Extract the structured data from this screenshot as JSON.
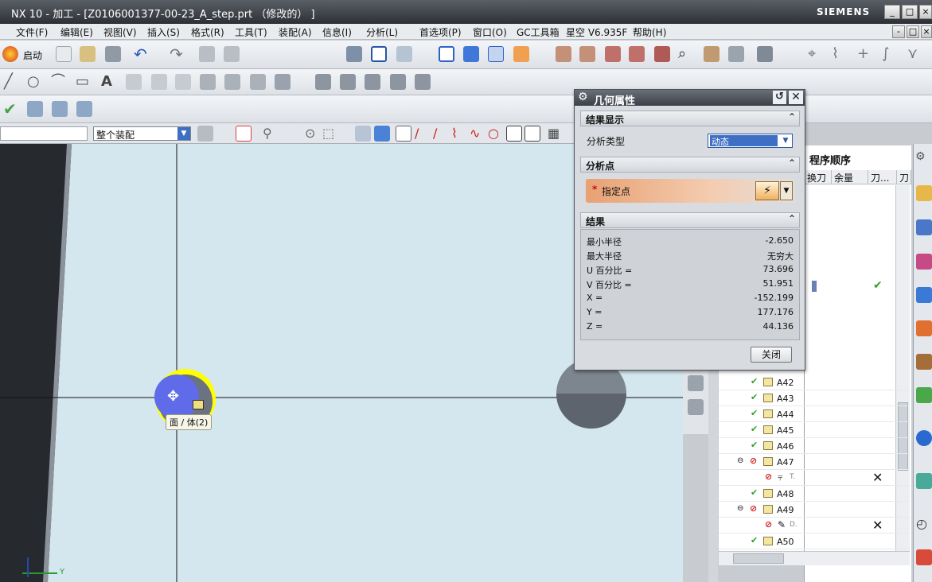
{
  "window": {
    "title": "NX 10 - 加工 - [Z0106001377-00-23_A_step.prt （修改的） ]",
    "brand": "SIEMENS"
  },
  "menu": [
    "文件(F)",
    "编辑(E)",
    "视图(V)",
    "插入(S)",
    "格式(R)",
    "工具(T)",
    "装配(A)",
    "信息(I)",
    "分析(L)",
    "首选项(P)",
    "窗口(O)",
    "GC工具箱",
    "星空 V6.935F",
    "帮助(H)"
  ],
  "toolbar": {
    "start_label": "启动",
    "assembly_filter": "整个装配"
  },
  "graphics": {
    "tooltip": "面 / 体(2)",
    "axis_label": "Y"
  },
  "dialog": {
    "title": "几何属性",
    "section_result_display": "结果显示",
    "analysis_type_label": "分析类型",
    "analysis_type_value": "动态",
    "section_analysis_point": "分析点",
    "point_required_mark": "*",
    "point_label": "指定点",
    "section_results": "结果",
    "results": [
      {
        "label": "最小半径",
        "value": "-2.650"
      },
      {
        "label": "最大半径",
        "value": "无穷大"
      },
      {
        "label": "U 百分比 =",
        "value": "73.696"
      },
      {
        "label": "V 百分比 =",
        "value": "51.951"
      },
      {
        "label": "X =",
        "value": "-152.199"
      },
      {
        "label": "Y =",
        "value": "177.176"
      },
      {
        "label": "Z =",
        "value": "44.136"
      }
    ],
    "close_label": "关闭"
  },
  "navigator": {
    "title": "程序顺序",
    "columns": [
      "换刀",
      "余量",
      "刀...",
      "刀"
    ],
    "operations": [
      {
        "name": "A42",
        "status": "ok"
      },
      {
        "name": "A43",
        "status": "ok"
      },
      {
        "name": "A44",
        "status": "ok"
      },
      {
        "name": "A45",
        "status": "ok"
      },
      {
        "name": "A46",
        "status": "ok"
      },
      {
        "name": "A47",
        "status": "error"
      },
      {
        "name": "T.",
        "status": "child-error"
      },
      {
        "name": "A48",
        "status": "ok"
      },
      {
        "name": "A49",
        "status": "error"
      },
      {
        "name": "D.",
        "status": "child-error"
      },
      {
        "name": "A50",
        "status": "ok"
      }
    ],
    "status_colors": {
      "ok": "#2ea32e",
      "error": "#d02020"
    }
  }
}
